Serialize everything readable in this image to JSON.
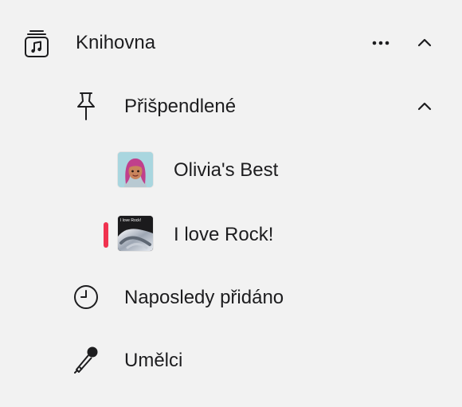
{
  "sidebar": {
    "library": {
      "label": "Knihovna",
      "icon": "music-library-icon",
      "more_icon": "more-icon",
      "collapse_icon": "chevron-up-icon"
    },
    "pinned": {
      "label": "Přišpendlené",
      "icon": "pin-icon",
      "collapse_icon": "chevron-up-icon"
    },
    "playlists": [
      {
        "label": "Olivia's Best",
        "artwork": "memoji-avatar-artwork"
      },
      {
        "label": "I love Rock!",
        "artwork": "rock-playlist-artwork",
        "artwork_text": "I love Rock!",
        "now_playing": true
      }
    ],
    "recently_added": {
      "label": "Naposledy přidáno",
      "icon": "clock-icon"
    },
    "artists": {
      "label": "Umělci",
      "icon": "microphone-icon"
    }
  },
  "colors": {
    "background": "#f2f2f2",
    "text": "#1d1d1f",
    "now_playing_indicator": "#f0324f",
    "memoji_background": "#a9d6df",
    "memoji_hair": "#c0408c"
  }
}
